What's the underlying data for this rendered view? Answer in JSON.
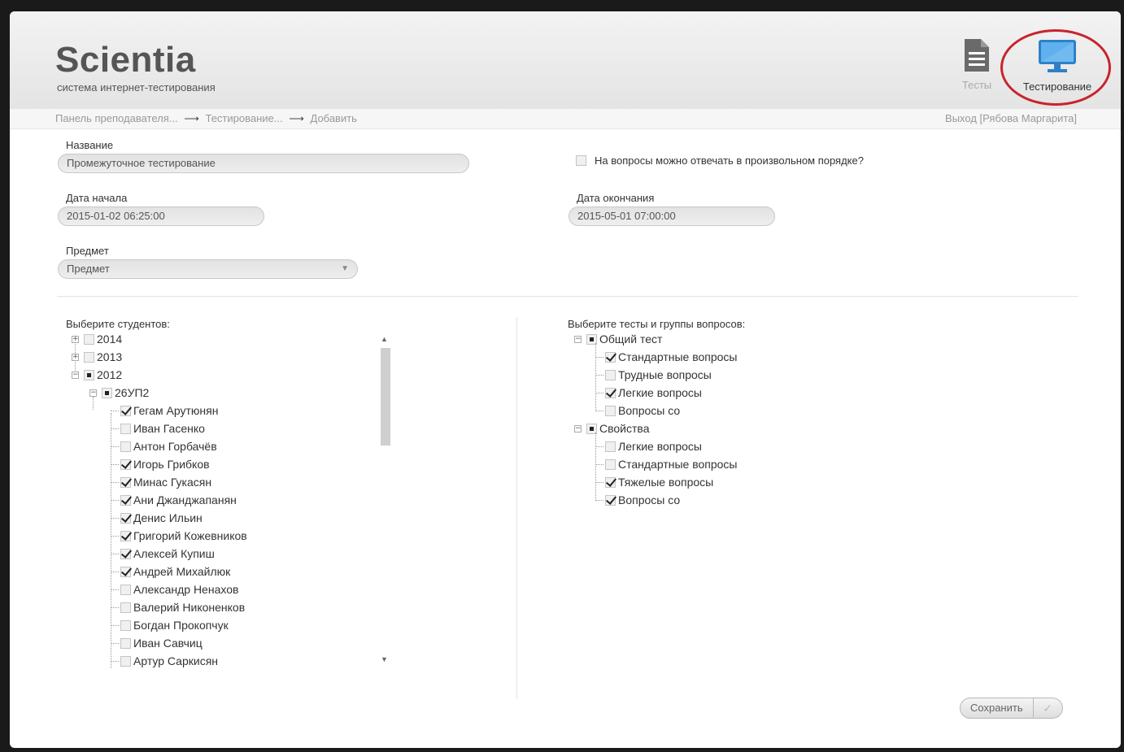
{
  "header": {
    "title": "Scientia",
    "subtitle": "система интернет-тестирования",
    "nav": [
      {
        "label": "Тесты",
        "icon": "document-icon"
      },
      {
        "label": "Тестирование",
        "icon": "monitor-icon"
      }
    ]
  },
  "breadcrumb": {
    "items": [
      "Панель преподавателя...",
      "Тестирование...",
      "Добавить"
    ],
    "arrow": "⟶"
  },
  "logout": "Выход [Рябова Маргарита]",
  "form": {
    "name_label": "Название",
    "name_value": "Промежуточное тестирование",
    "random_order_label": "На вопросы можно отвечать в произвольном порядке?",
    "start_label": "Дата начала",
    "start_value": "2015-01-02 06:25:00",
    "end_label": "Дата окончания",
    "end_value": "2015-05-01 07:00:00",
    "subject_label": "Предмет",
    "subject_value": "Предмет"
  },
  "students": {
    "title": "Выберите студентов:",
    "years": [
      "2014",
      "2013",
      "2012"
    ],
    "group": "26УП2",
    "list": [
      {
        "name": "Гегам Арутюнян",
        "checked": true
      },
      {
        "name": "Иван Гасенко",
        "checked": false
      },
      {
        "name": "Антон Горбачёв",
        "checked": false
      },
      {
        "name": "Игорь Грибков",
        "checked": true
      },
      {
        "name": "Минас Гукасян",
        "checked": true
      },
      {
        "name": "Ани Джанджапанян",
        "checked": true
      },
      {
        "name": "Денис Ильин",
        "checked": true
      },
      {
        "name": "Григорий Кожевников",
        "checked": true
      },
      {
        "name": "Алексей Купиш",
        "checked": true
      },
      {
        "name": "Андрей Михайлюк",
        "checked": true
      },
      {
        "name": "Александр Ненахов",
        "checked": false
      },
      {
        "name": "Валерий Никоненков",
        "checked": false
      },
      {
        "name": "Богдан Прокопчук",
        "checked": false
      },
      {
        "name": "Иван Савчиц",
        "checked": false
      },
      {
        "name": "Артур Саркисян",
        "checked": false
      }
    ]
  },
  "tests": {
    "title": "Выберите тесты и группы вопросов:",
    "groups": [
      {
        "name": "Общий тест",
        "items": [
          {
            "name": "Стандартные вопросы",
            "checked": true
          },
          {
            "name": "Трудные вопросы",
            "checked": false
          },
          {
            "name": "Легкие вопросы",
            "checked": true
          },
          {
            "name": "Вопросы со",
            "checked": false
          }
        ]
      },
      {
        "name": "Свойства",
        "items": [
          {
            "name": "Легкие вопросы",
            "checked": false
          },
          {
            "name": "Стандартные вопросы",
            "checked": false
          },
          {
            "name": "Тяжелые вопросы",
            "checked": true
          },
          {
            "name": "Вопросы со",
            "checked": true
          }
        ]
      }
    ]
  },
  "save_label": "Сохранить",
  "colors": {
    "accent_ring": "#c8232c",
    "monitor": "#3a8fd6"
  }
}
